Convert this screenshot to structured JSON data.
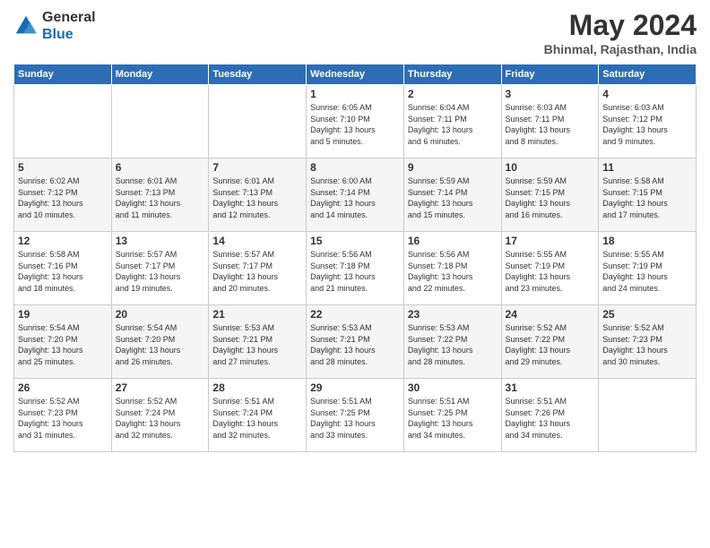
{
  "logo": {
    "general": "General",
    "blue": "Blue"
  },
  "header": {
    "month_year": "May 2024",
    "location": "Bhinmal, Rajasthan, India"
  },
  "days_header": [
    "Sunday",
    "Monday",
    "Tuesday",
    "Wednesday",
    "Thursday",
    "Friday",
    "Saturday"
  ],
  "weeks": [
    [
      {
        "day": "",
        "info": ""
      },
      {
        "day": "",
        "info": ""
      },
      {
        "day": "",
        "info": ""
      },
      {
        "day": "1",
        "info": "Sunrise: 6:05 AM\nSunset: 7:10 PM\nDaylight: 13 hours\nand 5 minutes."
      },
      {
        "day": "2",
        "info": "Sunrise: 6:04 AM\nSunset: 7:11 PM\nDaylight: 13 hours\nand 6 minutes."
      },
      {
        "day": "3",
        "info": "Sunrise: 6:03 AM\nSunset: 7:11 PM\nDaylight: 13 hours\nand 8 minutes."
      },
      {
        "day": "4",
        "info": "Sunrise: 6:03 AM\nSunset: 7:12 PM\nDaylight: 13 hours\nand 9 minutes."
      }
    ],
    [
      {
        "day": "5",
        "info": "Sunrise: 6:02 AM\nSunset: 7:12 PM\nDaylight: 13 hours\nand 10 minutes."
      },
      {
        "day": "6",
        "info": "Sunrise: 6:01 AM\nSunset: 7:13 PM\nDaylight: 13 hours\nand 11 minutes."
      },
      {
        "day": "7",
        "info": "Sunrise: 6:01 AM\nSunset: 7:13 PM\nDaylight: 13 hours\nand 12 minutes."
      },
      {
        "day": "8",
        "info": "Sunrise: 6:00 AM\nSunset: 7:14 PM\nDaylight: 13 hours\nand 14 minutes."
      },
      {
        "day": "9",
        "info": "Sunrise: 5:59 AM\nSunset: 7:14 PM\nDaylight: 13 hours\nand 15 minutes."
      },
      {
        "day": "10",
        "info": "Sunrise: 5:59 AM\nSunset: 7:15 PM\nDaylight: 13 hours\nand 16 minutes."
      },
      {
        "day": "11",
        "info": "Sunrise: 5:58 AM\nSunset: 7:15 PM\nDaylight: 13 hours\nand 17 minutes."
      }
    ],
    [
      {
        "day": "12",
        "info": "Sunrise: 5:58 AM\nSunset: 7:16 PM\nDaylight: 13 hours\nand 18 minutes."
      },
      {
        "day": "13",
        "info": "Sunrise: 5:57 AM\nSunset: 7:17 PM\nDaylight: 13 hours\nand 19 minutes."
      },
      {
        "day": "14",
        "info": "Sunrise: 5:57 AM\nSunset: 7:17 PM\nDaylight: 13 hours\nand 20 minutes."
      },
      {
        "day": "15",
        "info": "Sunrise: 5:56 AM\nSunset: 7:18 PM\nDaylight: 13 hours\nand 21 minutes."
      },
      {
        "day": "16",
        "info": "Sunrise: 5:56 AM\nSunset: 7:18 PM\nDaylight: 13 hours\nand 22 minutes."
      },
      {
        "day": "17",
        "info": "Sunrise: 5:55 AM\nSunset: 7:19 PM\nDaylight: 13 hours\nand 23 minutes."
      },
      {
        "day": "18",
        "info": "Sunrise: 5:55 AM\nSunset: 7:19 PM\nDaylight: 13 hours\nand 24 minutes."
      }
    ],
    [
      {
        "day": "19",
        "info": "Sunrise: 5:54 AM\nSunset: 7:20 PM\nDaylight: 13 hours\nand 25 minutes."
      },
      {
        "day": "20",
        "info": "Sunrise: 5:54 AM\nSunset: 7:20 PM\nDaylight: 13 hours\nand 26 minutes."
      },
      {
        "day": "21",
        "info": "Sunrise: 5:53 AM\nSunset: 7:21 PM\nDaylight: 13 hours\nand 27 minutes."
      },
      {
        "day": "22",
        "info": "Sunrise: 5:53 AM\nSunset: 7:21 PM\nDaylight: 13 hours\nand 28 minutes."
      },
      {
        "day": "23",
        "info": "Sunrise: 5:53 AM\nSunset: 7:22 PM\nDaylight: 13 hours\nand 28 minutes."
      },
      {
        "day": "24",
        "info": "Sunrise: 5:52 AM\nSunset: 7:22 PM\nDaylight: 13 hours\nand 29 minutes."
      },
      {
        "day": "25",
        "info": "Sunrise: 5:52 AM\nSunset: 7:23 PM\nDaylight: 13 hours\nand 30 minutes."
      }
    ],
    [
      {
        "day": "26",
        "info": "Sunrise: 5:52 AM\nSunset: 7:23 PM\nDaylight: 13 hours\nand 31 minutes."
      },
      {
        "day": "27",
        "info": "Sunrise: 5:52 AM\nSunset: 7:24 PM\nDaylight: 13 hours\nand 32 minutes."
      },
      {
        "day": "28",
        "info": "Sunrise: 5:51 AM\nSunset: 7:24 PM\nDaylight: 13 hours\nand 32 minutes."
      },
      {
        "day": "29",
        "info": "Sunrise: 5:51 AM\nSunset: 7:25 PM\nDaylight: 13 hours\nand 33 minutes."
      },
      {
        "day": "30",
        "info": "Sunrise: 5:51 AM\nSunset: 7:25 PM\nDaylight: 13 hours\nand 34 minutes."
      },
      {
        "day": "31",
        "info": "Sunrise: 5:51 AM\nSunset: 7:26 PM\nDaylight: 13 hours\nand 34 minutes."
      },
      {
        "day": "",
        "info": ""
      }
    ]
  ]
}
